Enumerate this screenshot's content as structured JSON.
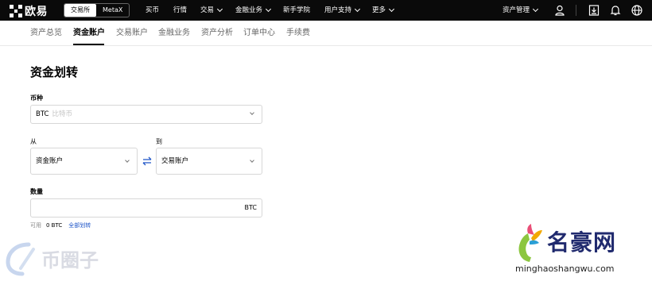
{
  "topnav": {
    "logo": "欧易",
    "switch": [
      "交易所",
      "MetaX"
    ],
    "items": [
      "买币",
      "行情",
      "交易",
      "金融业务",
      "新手学院",
      "用户支持",
      "更多"
    ],
    "asset_mgmt": "资产管理",
    "icons": [
      "user-icon",
      "download-icon",
      "bell-icon",
      "globe-icon"
    ]
  },
  "subnav": [
    "资产总览",
    "资金账户",
    "交易账户",
    "金融业务",
    "资产分析",
    "订单中心",
    "手续费"
  ],
  "page": {
    "title": "资金划转",
    "currency_label": "币种",
    "currency_value": "BTC",
    "currency_hint": "比特币",
    "from_label": "从",
    "to_label": "到",
    "from_value": "资金账户",
    "to_value": "交易账户",
    "amount_label": "数量",
    "amount_unit": "BTC",
    "available_label": "可用",
    "available_value": "0 BTC",
    "transfer_all": "全部划转"
  },
  "watermarks": {
    "left": "币圈子",
    "right_brand": "名豪网",
    "right_url": "minghaoshangwu.com"
  },
  "colors": {
    "topbar": "#0a0a0a",
    "link": "#1e55c8",
    "brand_blue": "#202a6e"
  }
}
